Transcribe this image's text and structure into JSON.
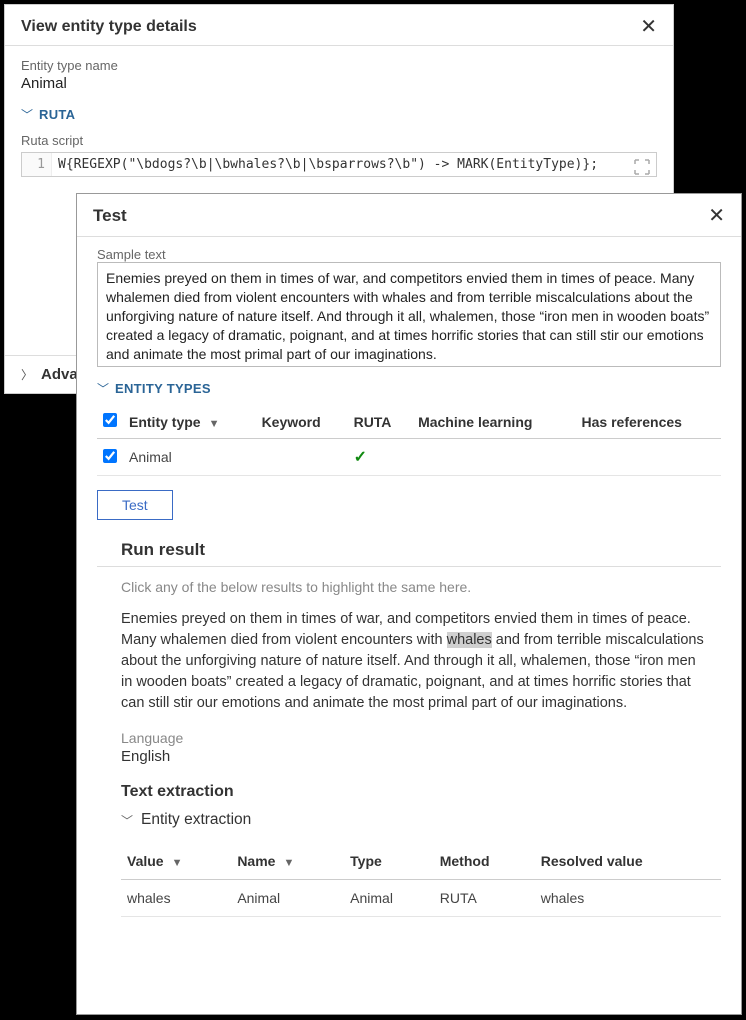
{
  "detailsPanel": {
    "title": "View entity type details",
    "entityTypeNameLabel": "Entity type name",
    "entityTypeName": "Animal",
    "rutaSectionLabel": "RUTA",
    "rutaScriptLabel": "Ruta script",
    "rutaLineNumber": "1",
    "rutaScript": "W{REGEXP(\"\\bdogs?\\b|\\bwhales?\\b|\\bsparrows?\\b\") -> MARK(EntityType)};",
    "advancedLabel": "Advar"
  },
  "testPanel": {
    "title": "Test",
    "sampleTextLabel": "Sample text",
    "sampleText": "Enemies preyed on them in times of war, and competitors envied them in times of peace. Many whalemen died from violent encounters with whales and from terrible miscalculations about the unforgiving nature of nature itself. And through it all, whalemen, those “iron men in wooden boats” created a legacy of dramatic, poignant, and at times horrific stories that can still stir our emotions and animate the most primal part of our imaginations.",
    "entityTypesSection": "ENTITY TYPES",
    "columns": {
      "entityType": "Entity type",
      "keyword": "Keyword",
      "ruta": "RUTA",
      "ml": "Machine learning",
      "hasRefs": "Has references"
    },
    "rows": [
      {
        "name": "Animal",
        "rutaCheck": true
      }
    ],
    "testButton": "Test",
    "runResult": {
      "heading": "Run result",
      "hint": "Click any of the below results to highlight the same here.",
      "textBefore": "Enemies preyed on them in times of war, and competitors envied them in times of peace. Many whalemen died from violent encounters with ",
      "highlight": "whales",
      "textAfter": " and from terrible miscalculations about the unforgiving nature of nature itself. And through it all, whalemen, those “iron men in wooden boats” created a legacy of dramatic, poignant, and at times horrific stories that can still stir our emotions and animate the most primal part of our imaginations.",
      "languageLabel": "Language",
      "languageValue": "English",
      "textExtractionHeading": "Text extraction",
      "entityExtractionHeading": "Entity extraction",
      "extractionColumns": {
        "value": "Value",
        "name": "Name",
        "type": "Type",
        "method": "Method",
        "resolved": "Resolved value"
      },
      "extractionRows": [
        {
          "value": "whales",
          "name": "Animal",
          "type": "Animal",
          "method": "RUTA",
          "resolved": "whales"
        }
      ]
    }
  }
}
